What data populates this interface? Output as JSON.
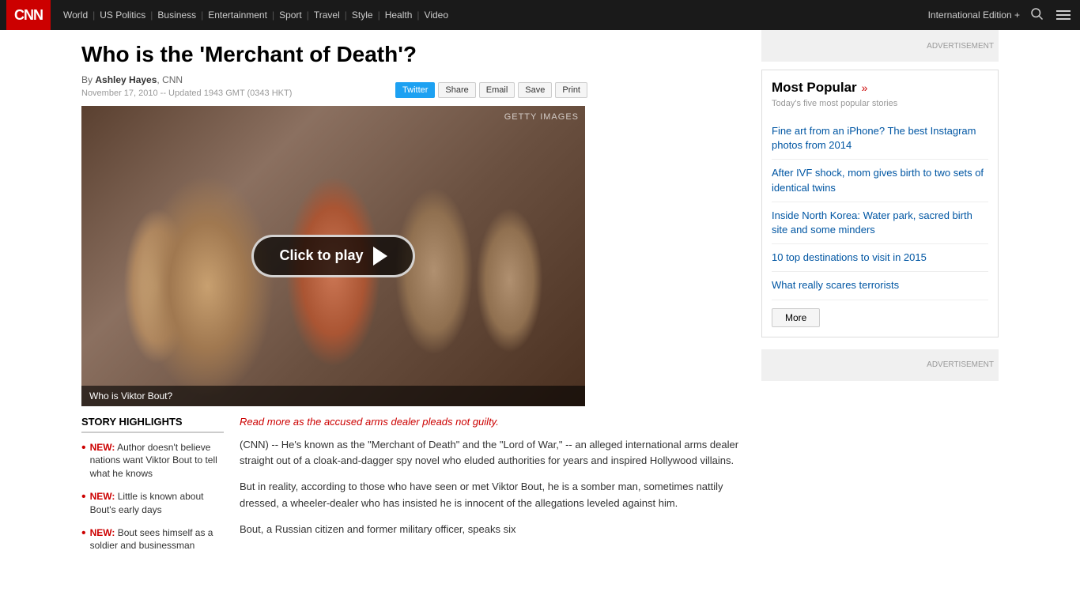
{
  "nav": {
    "logo": "CNN",
    "links": [
      "World",
      "US Politics",
      "Business",
      "Entertainment",
      "Sport",
      "Travel",
      "Style",
      "Health",
      "Video"
    ],
    "international_edition": "International Edition +",
    "search_icon": "🔍",
    "menu_icon": "☰"
  },
  "article": {
    "title": "Who is the 'Merchant of Death'?",
    "byline_prefix": "By",
    "author": "Ashley Hayes",
    "author_suffix": ", CNN",
    "dateline": "November 17, 2010 -- Updated 1943 GMT (0343 HKT)",
    "lead_link": "Read more as the accused arms dealer pleads not guilty.",
    "paragraphs": [
      "(CNN) -- He's known as the \"Merchant of Death\" and the \"Lord of War,\" -- an alleged international arms dealer straight out of a cloak-and-dagger spy novel who eluded authorities for years and inspired Hollywood villains.",
      "But in reality, according to those who have seen or met Viktor Bout, he is a somber man, sometimes nattily dressed, a wheeler-dealer who has insisted he is innocent of the allegations leveled against him.",
      "Bout, a Russian citizen and former military officer, speaks six"
    ]
  },
  "video": {
    "caption": "Who is Viktor Bout?",
    "watermark": "GETTY IMAGES",
    "play_text": "Click to play"
  },
  "share_buttons": [
    "Twitter",
    "Share",
    "Email",
    "Save",
    "Print"
  ],
  "highlights": {
    "title": "STORY HIGHLIGHTS",
    "items": [
      {
        "new": "NEW:",
        "text": "Author doesn't believe nations want Viktor Bout to tell what he knows"
      },
      {
        "new": "NEW:",
        "text": "Little is known about Bout's early days"
      },
      {
        "new": "NEW:",
        "text": "Bout sees himself as a soldier and businessman"
      }
    ]
  },
  "sidebar": {
    "ad_label": "ADVERTISEMENT",
    "most_popular": {
      "title": "Most Popular",
      "subtitle": "Today's five most popular stories",
      "items": [
        "Fine art from an iPhone? The best Instagram photos from 2014",
        "After IVF shock, mom gives birth to two sets of identical twins",
        "Inside North Korea: Water park, sacred birth site and some minders",
        "10 top destinations to visit in 2015",
        "What really scares terrorists"
      ],
      "more_label": "More"
    },
    "ad_label_2": "ADVERTISEMENT"
  }
}
